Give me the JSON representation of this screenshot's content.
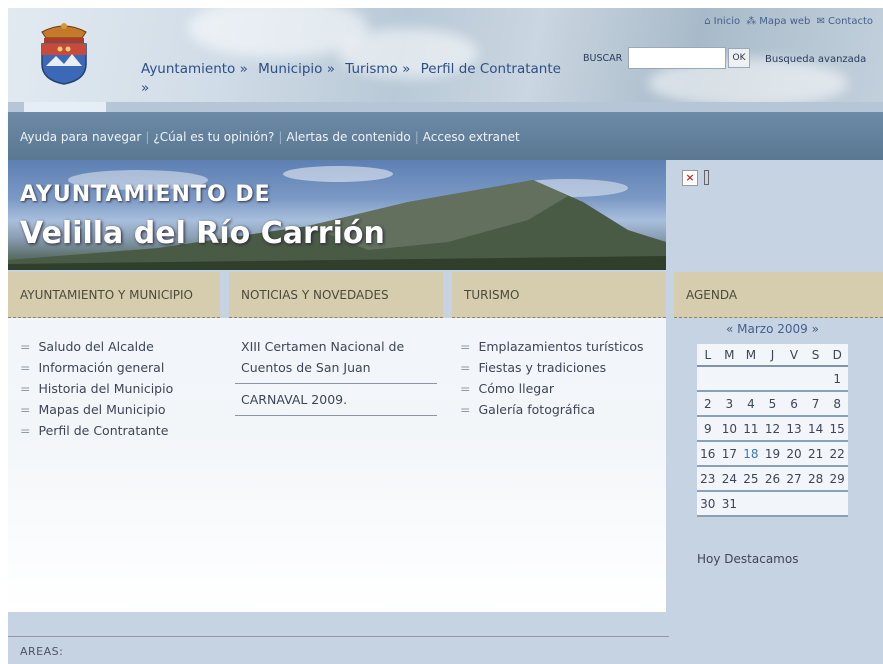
{
  "header": {
    "nav": [
      "Ayuntamiento »",
      "Municipio »",
      "Turismo »",
      "Perfil de Contratante »"
    ],
    "top_links": [
      {
        "icon": "home-icon",
        "label": "Inicio"
      },
      {
        "icon": "sitemap-icon",
        "label": "Mapa web"
      },
      {
        "icon": "mail-icon",
        "label": "Contacto"
      }
    ],
    "search": {
      "label": "BUSCAR",
      "value": "",
      "button": "OK",
      "advanced": "Busqueda avanzada"
    }
  },
  "utility_bar": [
    "Ayuda para navegar",
    "¿Cúal es tu opinión?",
    "Alertas de contenido",
    "Acceso extranet"
  ],
  "banner": {
    "line1": "AYUNTAMIENTO DE",
    "line2": "Velilla del Río Carrión"
  },
  "sections": {
    "ayuntamiento": {
      "title": "AYUNTAMIENTO Y MUNICIPIO",
      "items": [
        "Saludo del Alcalde",
        "Información general",
        "Historia del Municipio",
        "Mapas del Municipio",
        "Perfil de Contratante"
      ]
    },
    "noticias": {
      "title": "NOTICIAS Y NOVEDADES",
      "items": [
        "XIII Certamen Nacional de Cuentos de San Juan",
        "CARNAVAL 2009."
      ]
    },
    "turismo": {
      "title": "TURISMO",
      "items": [
        "Emplazamientos turísticos",
        "Fiestas y tradiciones",
        "Cómo llegar",
        "Galería fotográfica"
      ]
    },
    "agenda": {
      "title": "AGENDA",
      "month": "« Marzo 2009 »",
      "weekdays": [
        "L",
        "M",
        "M",
        "J",
        "V",
        "S",
        "D"
      ],
      "weeks": [
        [
          "",
          "",
          "",
          "",
          "",
          "",
          "1"
        ],
        [
          "2",
          "3",
          "4",
          "5",
          "6",
          "7",
          "8"
        ],
        [
          "9",
          "10",
          "11",
          "12",
          "13",
          "14",
          "15"
        ],
        [
          "16",
          "17",
          "18",
          "19",
          "20",
          "21",
          "22"
        ],
        [
          "23",
          "24",
          "25",
          "26",
          "27",
          "28",
          "29"
        ],
        [
          "30",
          "31",
          "",
          "",
          "",
          "",
          ""
        ]
      ],
      "today": "18",
      "highlight": "Hoy Destacamos"
    }
  },
  "footer": {
    "areas": "AREAS:"
  },
  "colors": {
    "accent": "#2e4f86",
    "section_header": "#d6cdaf",
    "utility_bar": "#5f7c96",
    "page_bg": "#c6d3e2"
  }
}
